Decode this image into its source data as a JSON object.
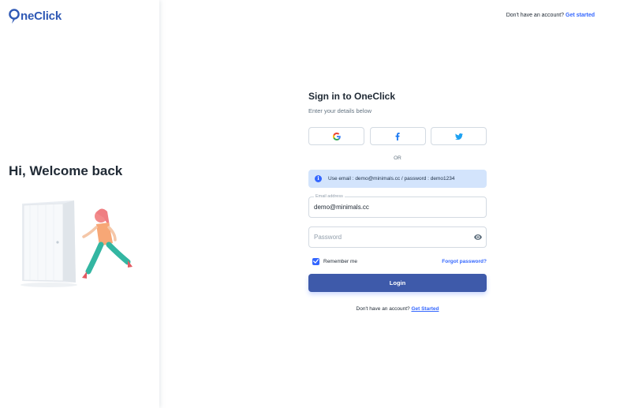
{
  "brand": {
    "name": "neClick",
    "accent_color": "#3366ff"
  },
  "left": {
    "welcome_title": "Hi, Welcome back",
    "illustration": "person-running-out-door-illustration"
  },
  "header": {
    "prompt": "Don't have an account?",
    "link": "Get started"
  },
  "form": {
    "title": "Sign in to OneClick",
    "subtitle": "Enter your details below",
    "social_buttons": [
      {
        "icon": "google-icon"
      },
      {
        "icon": "facebook-icon"
      },
      {
        "icon": "twitter-icon"
      }
    ],
    "divider": "OR",
    "info_alert": "Use email : demo@minimals.cc / password : demo1234",
    "email": {
      "label": "Email address",
      "value": "demo@minimals.cc"
    },
    "password": {
      "placeholder": "Password",
      "value": ""
    },
    "remember_me": {
      "label": "Remember me",
      "checked": true
    },
    "forgot_link": "Forgot password?",
    "login_label": "Login",
    "footer_prompt": "Don't have an account?",
    "footer_link": "Get Started"
  }
}
